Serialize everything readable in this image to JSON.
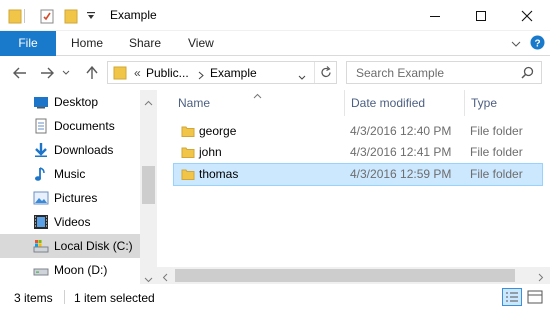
{
  "window": {
    "title": "Example"
  },
  "ribbon": {
    "tabs": [
      "File",
      "Home",
      "Share",
      "View"
    ]
  },
  "address": {
    "path": [
      "Public...",
      "Example"
    ],
    "overflow": "«"
  },
  "search": {
    "placeholder": "Search Example"
  },
  "nav_pane": {
    "items": [
      {
        "label": "Desktop",
        "icon": "desktop-icon"
      },
      {
        "label": "Documents",
        "icon": "documents-icon"
      },
      {
        "label": "Downloads",
        "icon": "downloads-icon"
      },
      {
        "label": "Music",
        "icon": "music-icon"
      },
      {
        "label": "Pictures",
        "icon": "pictures-icon"
      },
      {
        "label": "Videos",
        "icon": "videos-icon"
      },
      {
        "label": "Local Disk (C:)",
        "icon": "local-disk-icon",
        "selected": true
      },
      {
        "label": "Moon (D:)",
        "icon": "drive-icon"
      }
    ]
  },
  "file_list": {
    "columns": [
      "Name",
      "Date modified",
      "Type"
    ],
    "rows": [
      {
        "name": "george",
        "date": "4/3/2016 12:40 PM",
        "type": "File folder"
      },
      {
        "name": "john",
        "date": "4/3/2016 12:41 PM",
        "type": "File folder"
      },
      {
        "name": "thomas",
        "date": "4/3/2016 12:59 PM",
        "type": "File folder",
        "selected": true
      }
    ]
  },
  "status": {
    "item_count": "3 items",
    "selection": "1 item selected"
  },
  "colors": {
    "accent": "#1979ca",
    "selection": "#cce8ff",
    "selection_border": "#99d1ff",
    "header_text": "#4d6082",
    "folder": "#f0c548"
  }
}
